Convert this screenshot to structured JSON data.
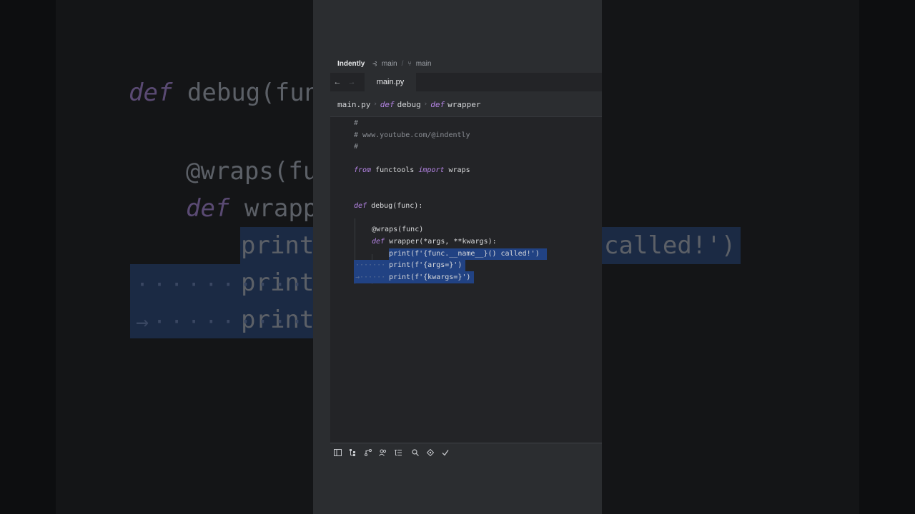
{
  "repo": {
    "name": "Indently",
    "module_label": "main",
    "branch_label": "main"
  },
  "tabs": {
    "back_icon": "arrow-left-icon",
    "forward_icon": "arrow-right-icon",
    "active_tab": "main.py"
  },
  "breadcrumbs": {
    "file": "main.py",
    "kw1": "def",
    "func1": "debug",
    "kw2": "def",
    "func2": "wrapper"
  },
  "code": {
    "l1": "#",
    "l2": "# www.youtube.com/@indently",
    "l3": "#",
    "l5_kw1": "from",
    "l5_mod": "functools",
    "l5_kw2": "import",
    "l5_name": "wraps",
    "l8_kw": "def",
    "l8_rest": "debug(func):",
    "l10": "@wraps(func)",
    "l11_kw": "def",
    "l11_rest": "wrapper(*args, **kwargs):",
    "l12": "print(f'{func.__name__}() called!')",
    "l13": "print(f'{args=}')",
    "l14": "print(f'{kwargs=}')"
  },
  "background": {
    "b1_kw": "def",
    "b1_rest": "debug(func",
    "b2": "@wraps(fun",
    "b3_kw": "def",
    "b3_rest": "wrappe",
    "b4": "print",
    "b4_tail": "called!')",
    "b5": "print",
    "b6": "print"
  },
  "toolbar": {
    "icons": [
      "sidebar-icon",
      "structure-icon",
      "branch-icon",
      "users-icon",
      "outline-icon",
      "search-icon",
      "run-icon",
      "check-icon"
    ]
  },
  "colors": {
    "panel_bg": "#2b2d30",
    "editor_bg": "#232427",
    "selection": "#214283",
    "keyword": "#b685e6"
  }
}
